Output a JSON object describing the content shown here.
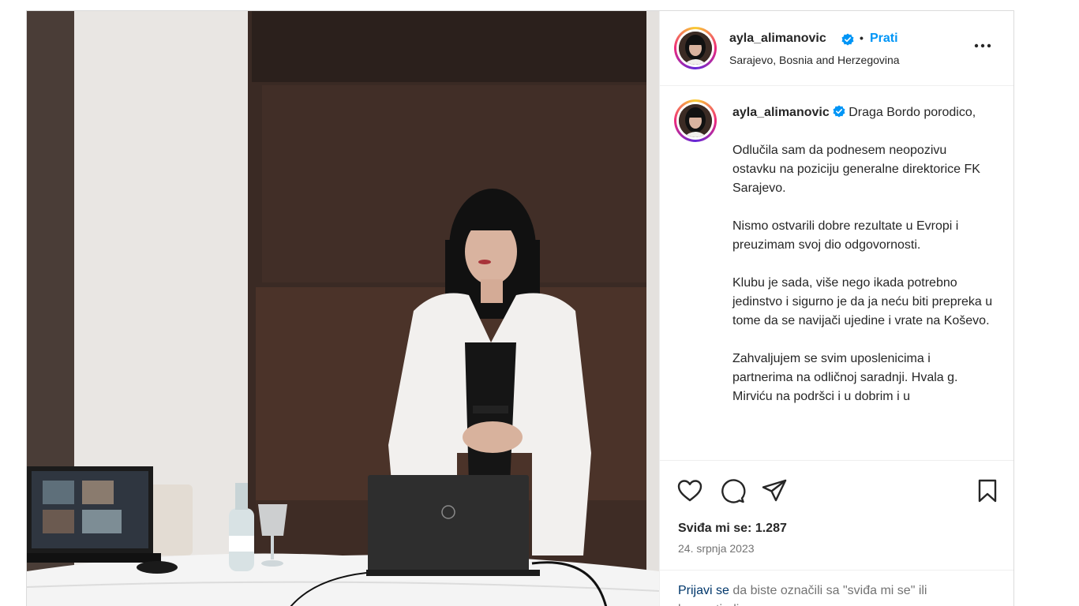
{
  "post": {
    "username": "ayla_alimanovic",
    "verified_icon": "verified-badge-icon",
    "separator": "•",
    "follow_label": "Prati",
    "location": "Sarajevo, Bosnia and Herzegovina",
    "more_label": "•••",
    "caption": "Draga Bordo porodico,\n\nOdlučila sam da podnesem neopozivu ostavku na poziciju generalne direktorice FK Sarajevo.\n\nNismo ostvarili dobre rezultate u Evropi i preuzimam svoj dio odgovornosti.\n\nKlubu je sada, više nego ikada potrebno jedinstvo i sigurno je da ja neću biti prepreka u tome da se navijači ujedine i vrate na Koševo.\n\nZahvaljujem se svim uposlenicima i partnerima na odličnoj saradnji. Hvala g. Mirviću na podršci i u dobrim i u",
    "likes_label": "Sviđa mi se: 1.287",
    "date": "24. srpnja 2023"
  },
  "actions": {
    "like_icon": "heart-icon",
    "comment_icon": "comment-icon",
    "share_icon": "send-icon",
    "save_icon": "bookmark-icon"
  },
  "login": {
    "link_label": "Prijavi se",
    "rest_text": " da biste označili sa \"sviđa mi se\" ili komentirali."
  },
  "colors": {
    "accent": "#0095f6",
    "text": "#262626",
    "muted": "#737373",
    "border": "#dbdbdb"
  }
}
